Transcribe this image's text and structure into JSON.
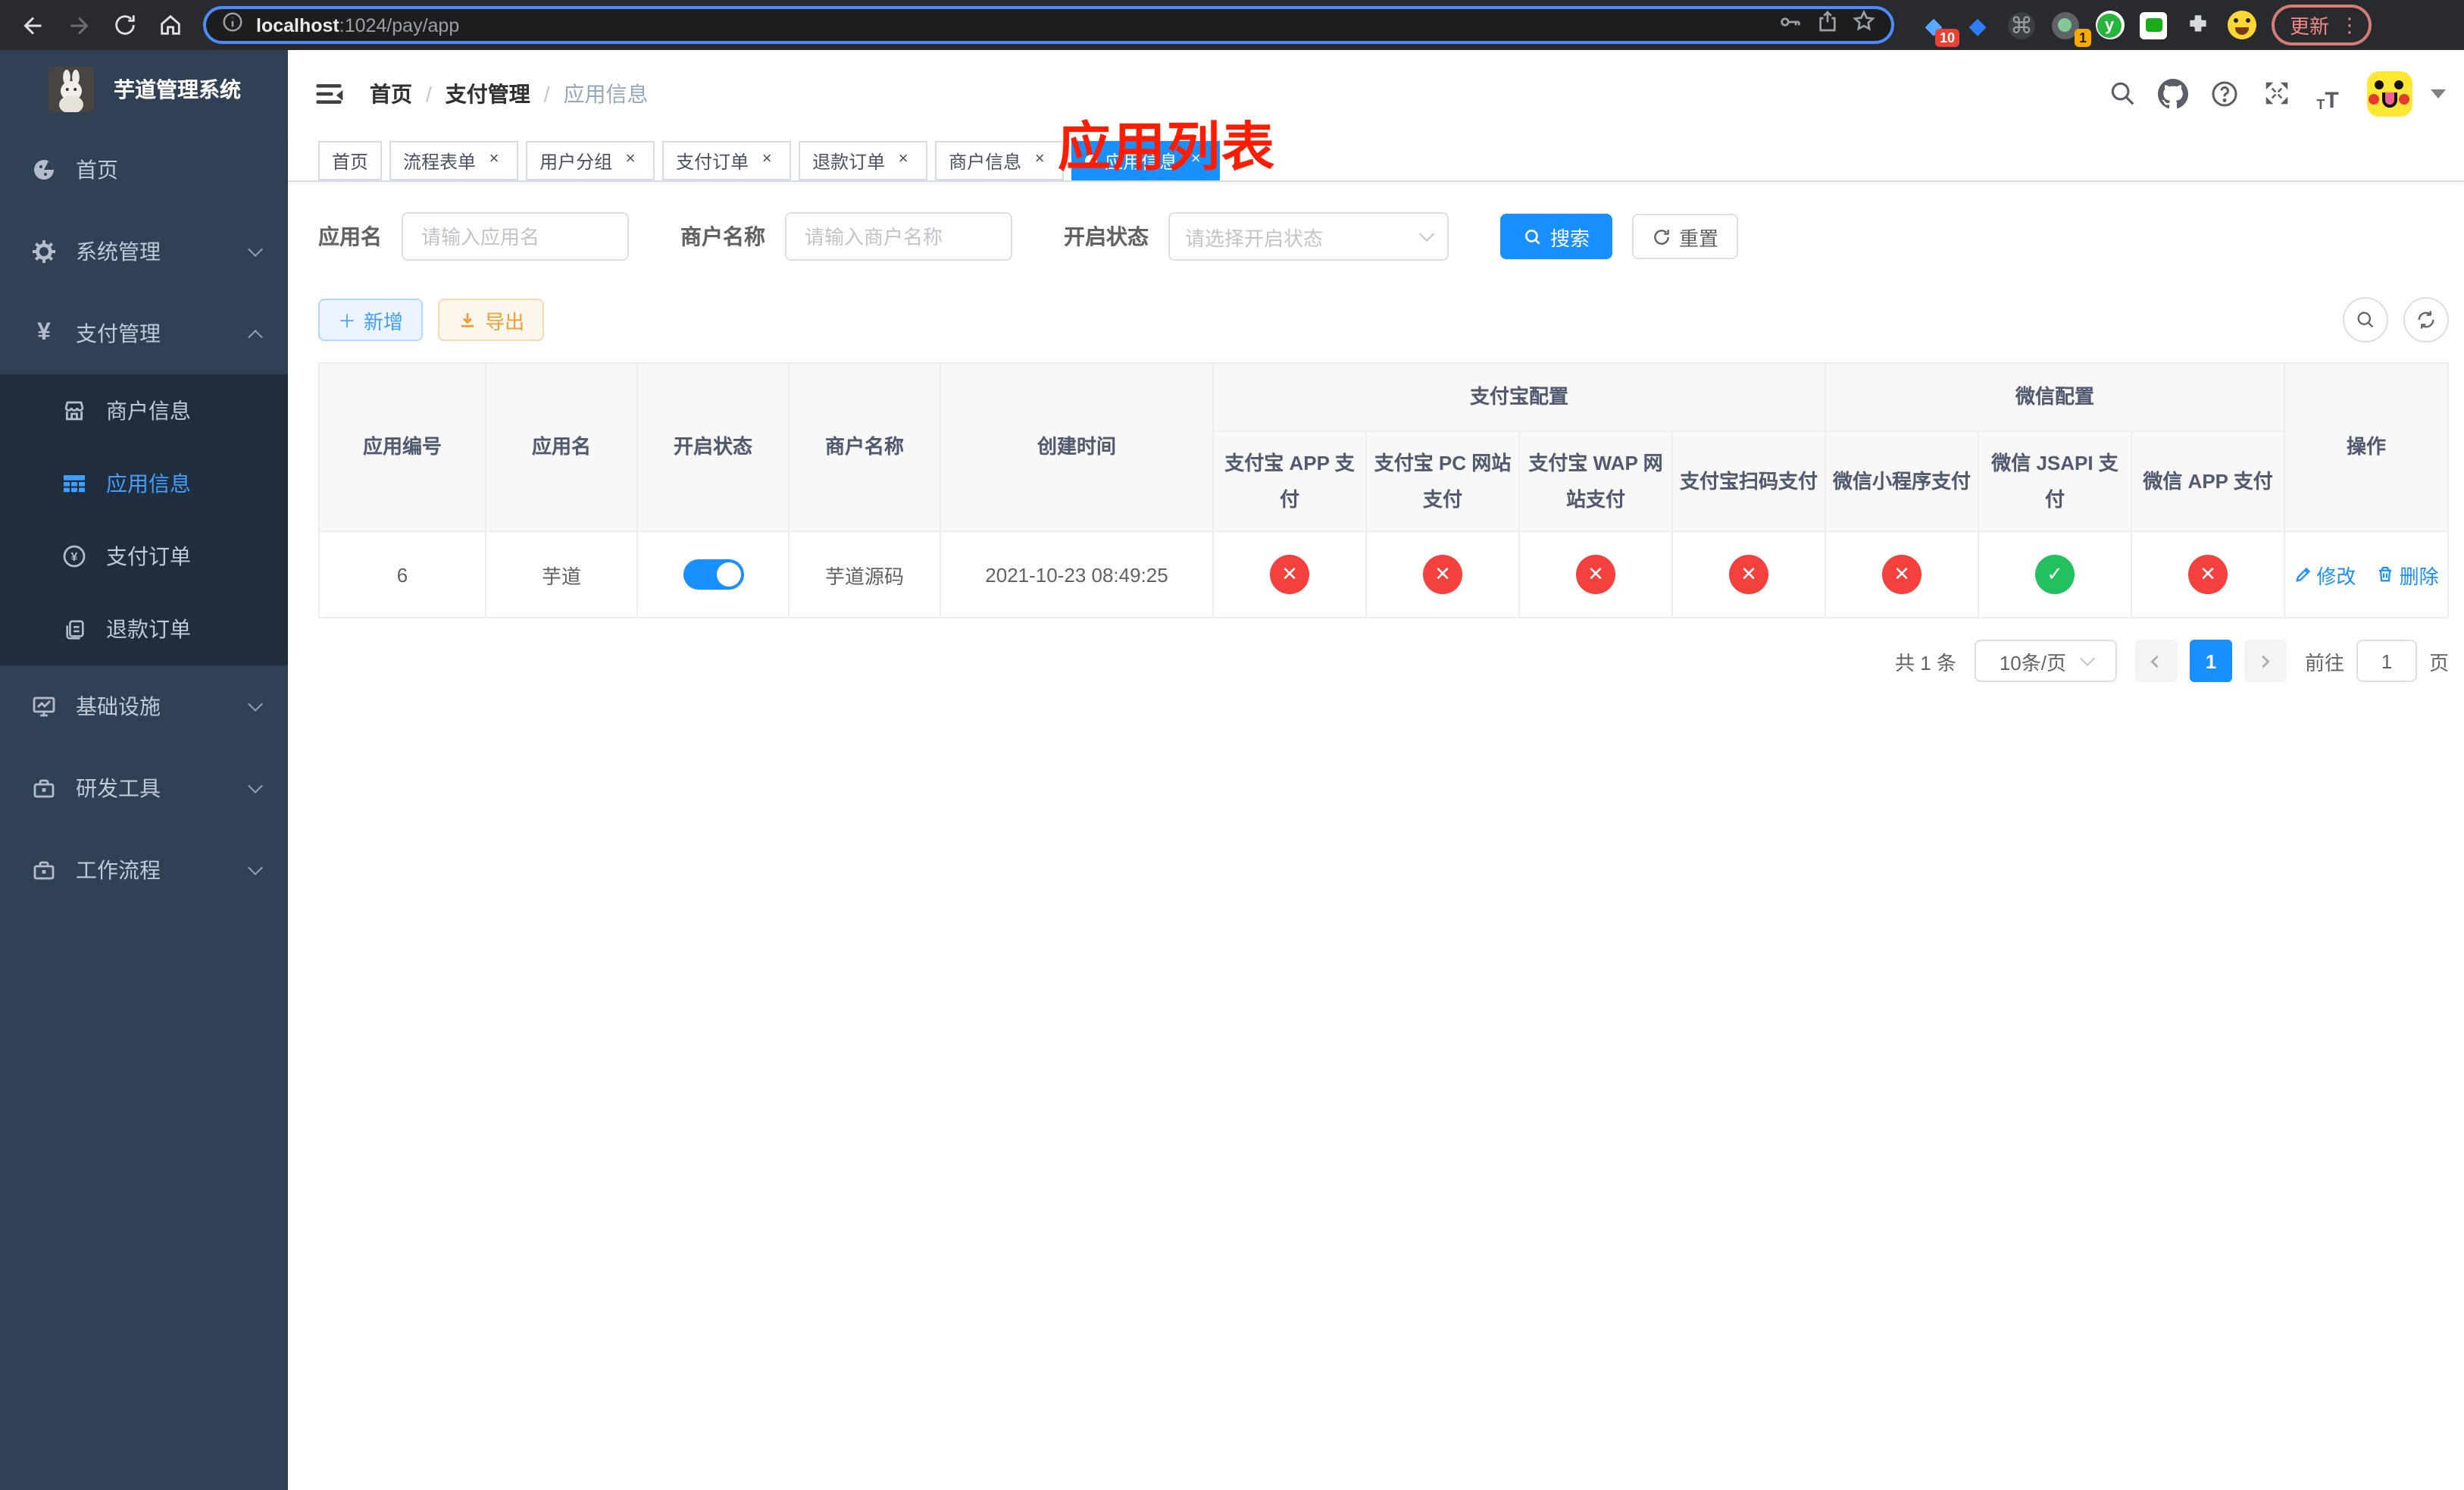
{
  "browser": {
    "url_host": "localhost",
    "url_rest": ":1024/pay/app",
    "update_label": "更新",
    "menu_dots": "⋮",
    "ext_badge_blocks": "10",
    "ext_badge_circle": "1",
    "ext_green_letter": "y"
  },
  "annotation": {
    "text": "应用列表",
    "color": "#fe1d00"
  },
  "colors": {
    "accent": "#1890ff",
    "link": "#409eff",
    "success": "#22c15e",
    "danger": "#f5413d",
    "warning": "#e6a23c",
    "sidebar_bg": "#304156",
    "submenu_bg": "#1f2d3d"
  },
  "icons": {
    "close": "×",
    "check": "✓",
    "cross": "✕",
    "plus": "＋",
    "command": "⌘",
    "diamond": "◆",
    "yuan": "¥"
  },
  "sidebar": {
    "title": "芋道管理系统",
    "items": [
      {
        "label": "首页"
      },
      {
        "label": "系统管理"
      },
      {
        "label": "支付管理"
      },
      {
        "label": "商户信息"
      },
      {
        "label": "应用信息"
      },
      {
        "label": "支付订单"
      },
      {
        "label": "退款订单"
      },
      {
        "label": "基础设施"
      },
      {
        "label": "研发工具"
      },
      {
        "label": "工作流程"
      }
    ]
  },
  "breadcrumb": {
    "separator": "/",
    "items": [
      "首页",
      "支付管理",
      "应用信息"
    ]
  },
  "tabs": [
    {
      "label": "首页"
    },
    {
      "label": "流程表单"
    },
    {
      "label": "用户分组"
    },
    {
      "label": "支付订单"
    },
    {
      "label": "退款订单"
    },
    {
      "label": "商户信息"
    },
    {
      "label": "应用信息"
    }
  ],
  "filters": {
    "app_name_label": "应用名",
    "app_name_placeholder": "请输入应用名",
    "merchant_label": "商户名称",
    "merchant_placeholder": "请输入商户名称",
    "status_label": "开启状态",
    "status_placeholder": "请选择开启状态",
    "search_label": "搜索",
    "reset_label": "重置"
  },
  "toolbar": {
    "add_label": "新增",
    "export_label": "导出"
  },
  "table": {
    "columns": [
      "应用编号",
      "应用名",
      "开启状态",
      "商户名称",
      "创建时间"
    ],
    "group_alipay": "支付宝配置",
    "group_wechat": "微信配置",
    "op_column": "操作",
    "pay_columns": [
      "支付宝 APP 支付",
      "支付宝 PC 网站支付",
      "支付宝 WAP 网站支付",
      "支付宝扫码支付",
      "微信小程序支付",
      "微信 JSAPI 支付",
      "微信 APP 支付"
    ],
    "row": {
      "id": "6",
      "name": "芋道",
      "enabled": true,
      "merchant": "芋道源码",
      "created": "2021-10-23 08:49:25",
      "pay_status": [
        "no",
        "no",
        "no",
        "no",
        "no",
        "yes",
        "no"
      ],
      "edit_label": "修改",
      "delete_label": "删除"
    }
  },
  "pagination": {
    "total_text": "共 1 条",
    "page_size": "10条/页",
    "current_page": "1",
    "goto_label": "前往",
    "goto_value": "1",
    "page_unit": "页"
  }
}
